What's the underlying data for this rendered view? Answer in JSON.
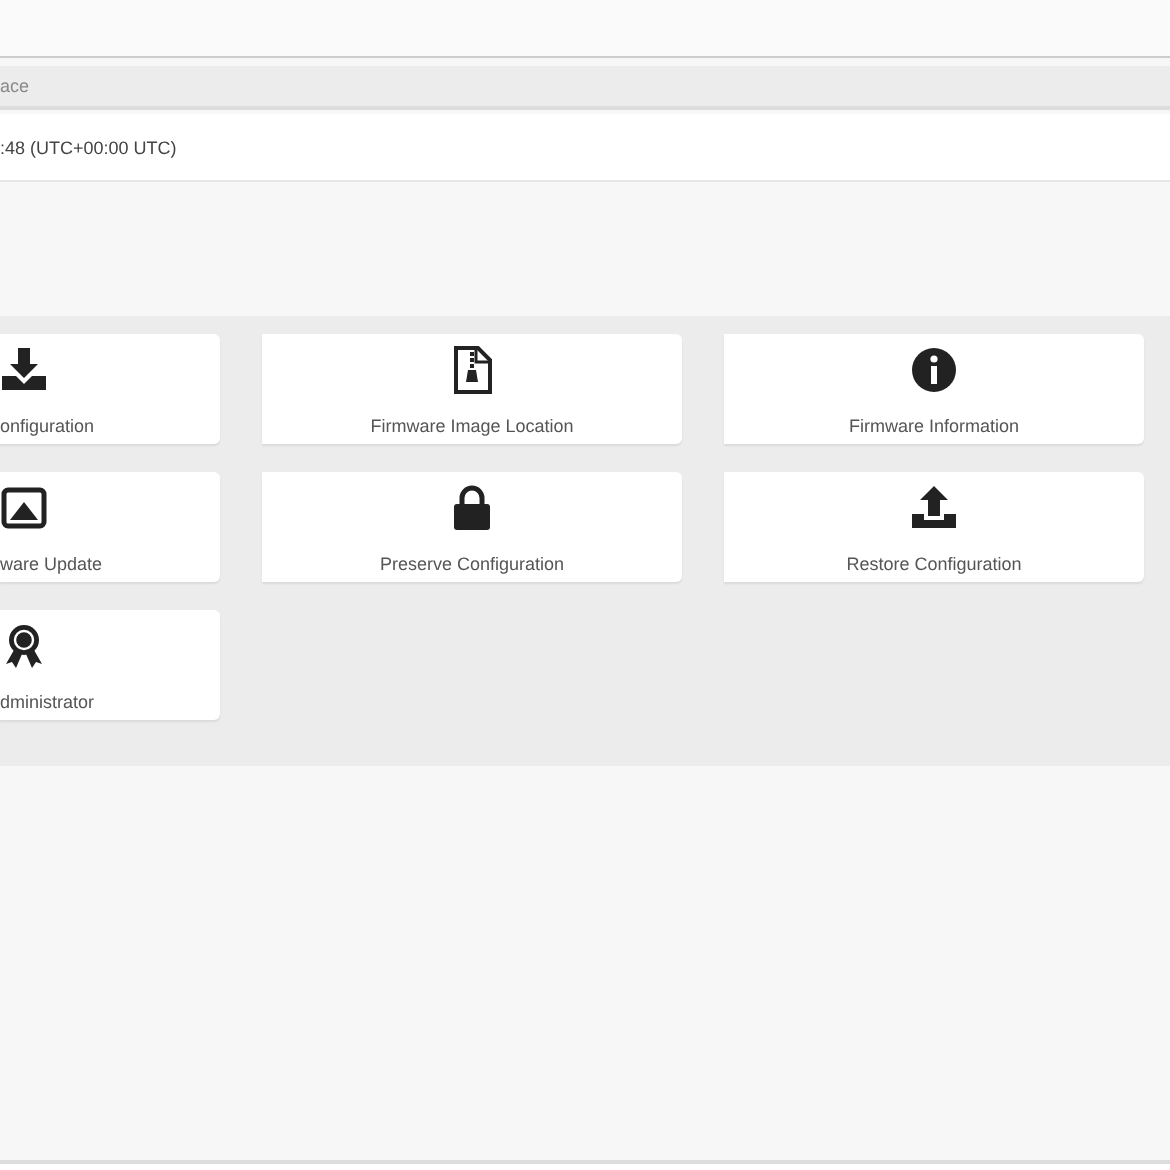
{
  "section": {
    "title": "ace"
  },
  "info_row": {
    "value": ":48 (UTC+00:00 UTC)"
  },
  "tiles": [
    {
      "kind": "download",
      "label": "onfiguration"
    },
    {
      "kind": "zip-file",
      "label": "Firmware Image Location"
    },
    {
      "kind": "info",
      "label": "Firmware Information"
    },
    {
      "kind": "image",
      "label": "ware Update"
    },
    {
      "kind": "lock",
      "label": "Preserve Configuration"
    },
    {
      "kind": "upload",
      "label": "Restore Configuration"
    },
    {
      "kind": "award",
      "label": "dministrator"
    }
  ]
}
